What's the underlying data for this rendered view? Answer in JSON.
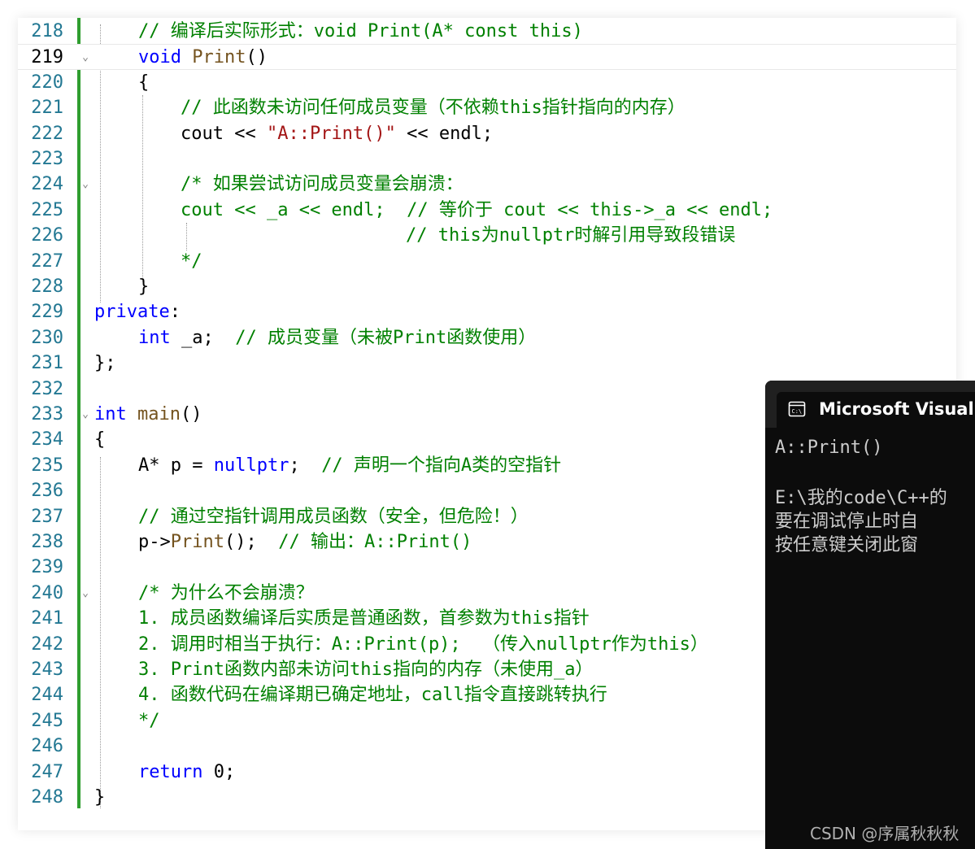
{
  "editor": {
    "line_numbers": [
      "218",
      "219",
      "220",
      "221",
      "222",
      "223",
      "224",
      "225",
      "226",
      "227",
      "228",
      "229",
      "230",
      "231",
      "232",
      "233",
      "234",
      "235",
      "236",
      "237",
      "238",
      "239",
      "240",
      "241",
      "242",
      "243",
      "244",
      "245",
      "246",
      "247",
      "248"
    ],
    "active_line": "219",
    "code": {
      "l218_comment": "// 编译后实际形式：void Print(A* const this)",
      "l219_kw": "void",
      "l219_fn": "Print",
      "l219_paren": "()",
      "l220": "{",
      "l221_comment": "// 此函数未访问任何成员变量（不依赖this指针指向的内存）",
      "l222_a": "cout << ",
      "l222_str": "\"A::Print()\"",
      "l222_b": " << endl;",
      "l224_comment": "/* 如果尝试访问成员变量会崩溃：",
      "l225_comment": "cout << _a << endl;  // 等价于 cout << this->_a << endl;",
      "l226_comment": "// this为nullptr时解引用导致段错误",
      "l227_comment": "*/",
      "l228": "}",
      "l229_kw": "private",
      "l229_colon": ":",
      "l230_kw": "int",
      "l230_var": " _a;  ",
      "l230_comment": "// 成员变量（未被Print函数使用）",
      "l231": "};",
      "l233_kw": "int",
      "l233_fn": "main",
      "l233_paren": "()",
      "l234": "{",
      "l235_a": "A* p = ",
      "l235_kw": "nullptr",
      "l235_b": ";  ",
      "l235_comment": "// 声明一个指向A类的空指针",
      "l237_comment": "// 通过空指针调用成员函数（安全，但危险！）",
      "l238_a": "p->",
      "l238_fn": "Print",
      "l238_b": "();  ",
      "l238_comment": "// 输出：A::Print()",
      "l240_comment": "/* 为什么不会崩溃？",
      "l241_comment": "1. 成员函数编译后实质是普通函数，首参数为this指针",
      "l242_comment": "2. 调用时相当于执行：A::Print(p);  （传入nullptr作为this）",
      "l243_comment": "3. Print函数内部未访问this指向的内存（未使用_a）",
      "l244_comment": "4. 函数代码在编译期已确定地址，call指令直接跳转执行",
      "l245_comment": "*/",
      "l247_kw": "return",
      "l247_rest": " 0;",
      "l248": "}"
    }
  },
  "console": {
    "title": "Microsoft Visual",
    "icon": "terminal-icon",
    "lines": [
      "A::Print()",
      "",
      "E:\\我的code\\C++的",
      "要在调试停止时自",
      "按任意键关闭此窗"
    ]
  },
  "watermark": "CSDN @序属秋秋秋",
  "colors": {
    "keyword": "#0000ff",
    "comment": "#008000",
    "string": "#a31515",
    "function": "#74531f",
    "line_number": "#237893",
    "change_bar": "#2f9e2f",
    "console_bg": "#0c0c0c"
  }
}
